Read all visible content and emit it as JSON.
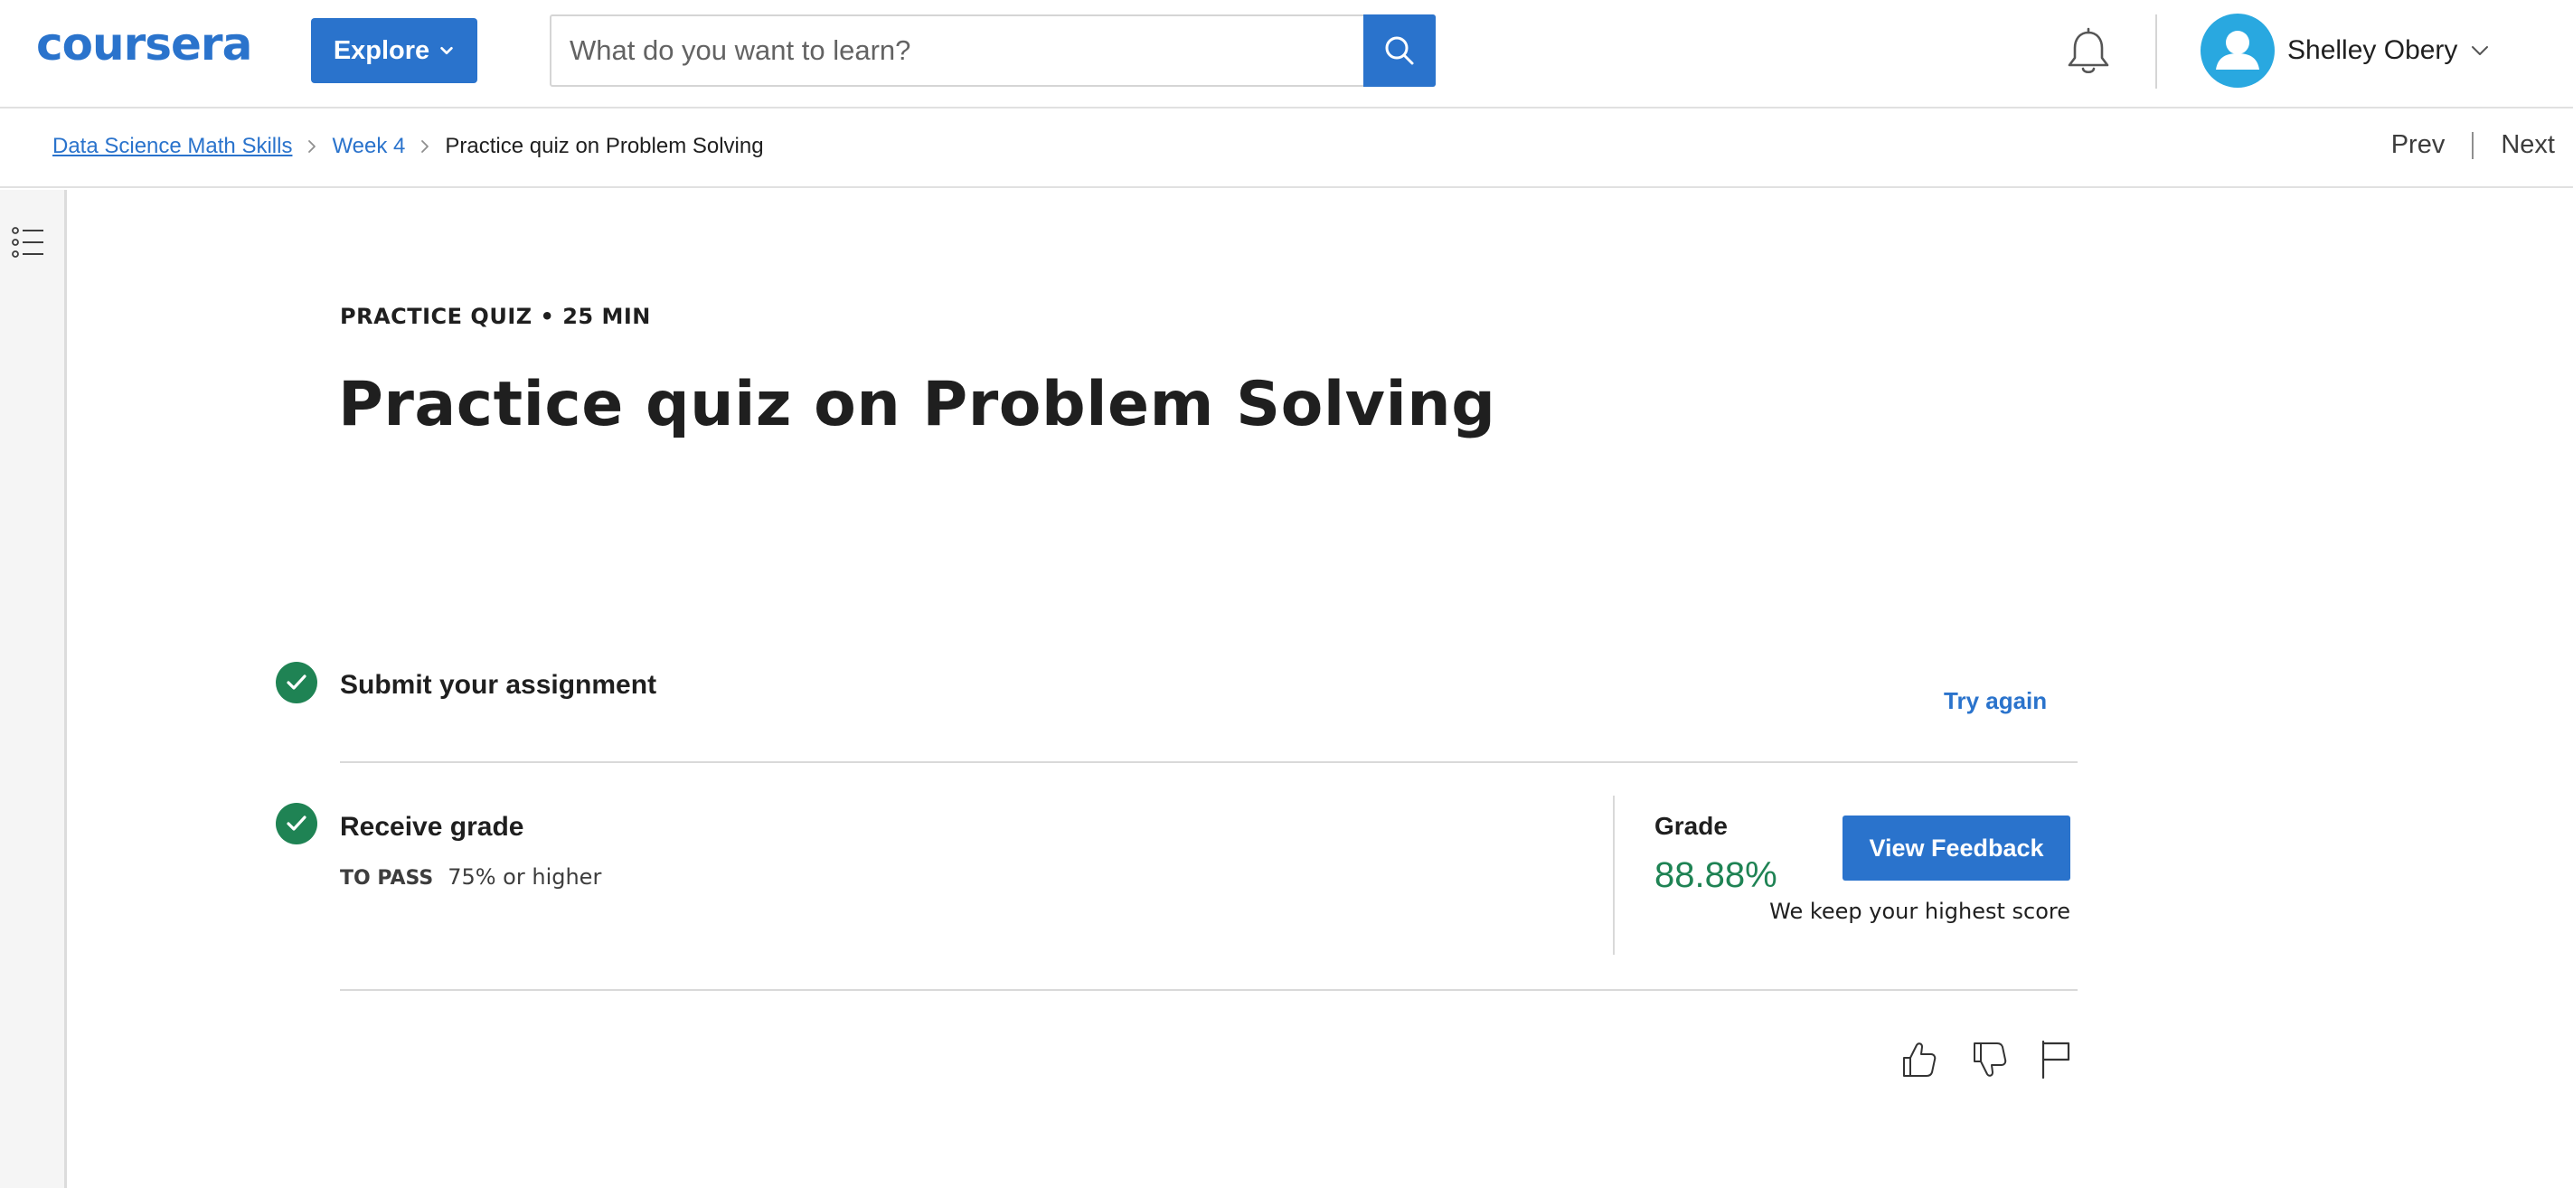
{
  "header": {
    "logo_text": "coursera",
    "explore_label": "Explore",
    "search_placeholder": "What do you want to learn?",
    "user_name": "Shelley Obery"
  },
  "breadcrumb": {
    "items": [
      "Data Science Math Skills",
      "Week 4",
      "Practice quiz on Problem Solving"
    ]
  },
  "nav": {
    "prev_label": "Prev",
    "next_label": "Next"
  },
  "quiz": {
    "eyebrow": "PRACTICE QUIZ • 25 MIN",
    "title": "Practice quiz on Problem Solving",
    "steps": [
      {
        "title": "Submit your assignment",
        "action_label": "Try again"
      },
      {
        "title": "Receive grade",
        "pass_label": "TO PASS",
        "pass_value": "75% or higher"
      }
    ],
    "grade_label": "Grade",
    "grade_value": "88.88%",
    "view_feedback_label": "View Feedback",
    "keep_score_note": "We keep your highest score"
  },
  "colors": {
    "brand_blue": "#2a73cc",
    "success_green": "#1f8354",
    "avatar_blue": "#29a8e0"
  },
  "icons": {
    "search": "search-icon",
    "bell": "bell-icon",
    "avatar": "user-avatar-icon",
    "outline": "list-outline-icon",
    "like": "thumbs-up-icon",
    "dislike": "thumbs-down-icon",
    "flag": "flag-icon",
    "check": "check-icon"
  }
}
